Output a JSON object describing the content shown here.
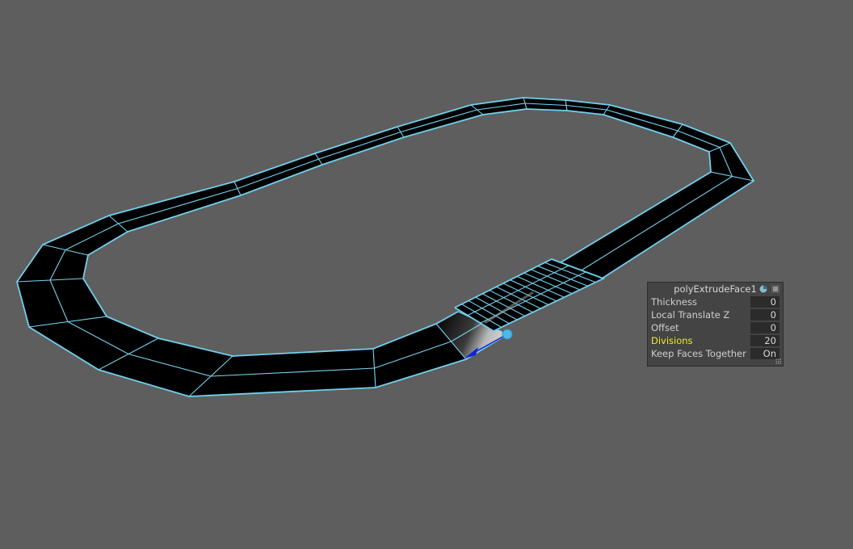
{
  "viewport": {
    "background": "#5e5e5e",
    "wire_color": "#79d3f0",
    "face_color": "#000000",
    "manipulator_color": "#1020e0",
    "manipulator_handle_color": "#4fb8e8"
  },
  "channel_box": {
    "title": "polyExtrudeFace1",
    "icons": [
      "display-icon",
      "menu-icon"
    ],
    "rows": [
      {
        "label": "Thickness",
        "value": "0",
        "highlight": false
      },
      {
        "label": "Local Translate Z",
        "value": "0",
        "highlight": false
      },
      {
        "label": "Offset",
        "value": "0",
        "highlight": false
      },
      {
        "label": "Divisions",
        "value": "20",
        "highlight": true
      },
      {
        "label": "Keep Faces Together",
        "value": "On",
        "highlight": false
      }
    ]
  }
}
